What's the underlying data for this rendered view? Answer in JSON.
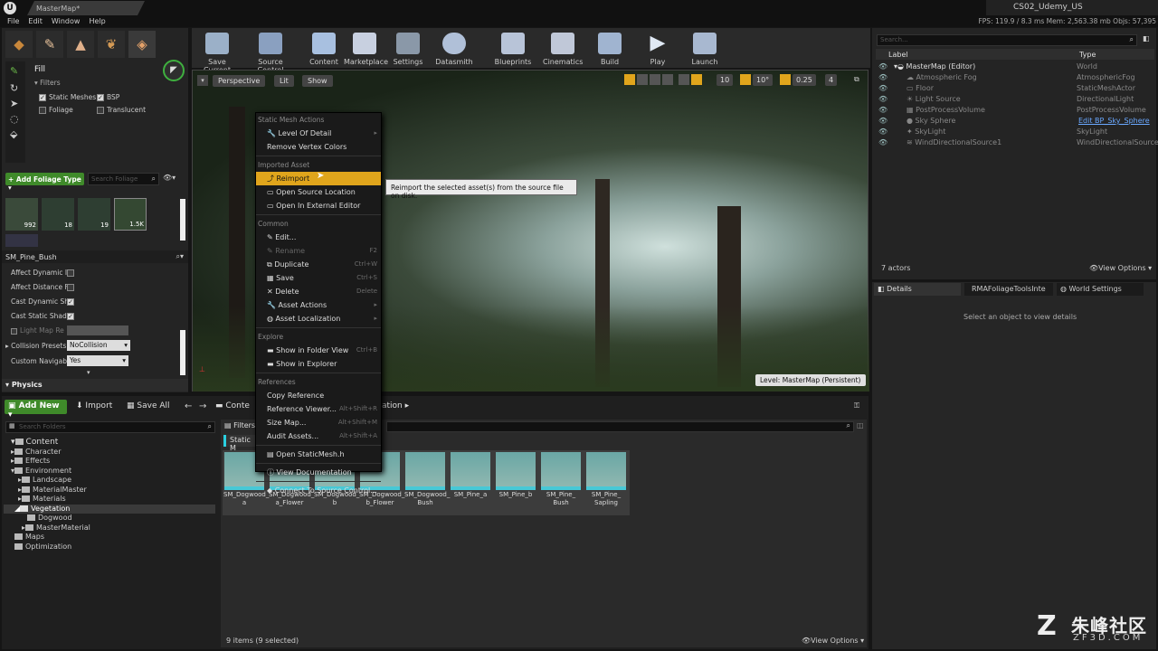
{
  "window": {
    "tab": "MasterMap*",
    "project": "CS02_Udemy_US",
    "stats": "FPS: 119.9 / 8.3 ms  Mem: 2,563.38 mb  Objs: 57,395"
  },
  "menu": [
    "File",
    "Edit",
    "Window",
    "Help"
  ],
  "modes": {
    "title": "Fill",
    "filters_label": "Filters",
    "filters": [
      {
        "label": "Static Meshes",
        "checked": true
      },
      {
        "label": "BSP",
        "checked": true
      },
      {
        "label": "Foliage",
        "checked": false
      },
      {
        "label": "Translucent",
        "checked": false
      }
    ],
    "add_foliage": "+ Add Foliage Type ▾",
    "search_placeholder": "Search Foliage",
    "tiles": [
      {
        "count": "992"
      },
      {
        "count": "18"
      },
      {
        "count": "19"
      },
      {
        "count": "1.5K"
      }
    ],
    "selected_name": "SM_Pine_Bush",
    "props": [
      {
        "label": "Affect Dynamic I",
        "checked": false
      },
      {
        "label": "Affect Distance F",
        "checked": false
      },
      {
        "label": "Cast Dynamic Sh",
        "checked": true
      },
      {
        "label": "Cast Static Shad",
        "checked": true
      },
      {
        "label": "Light Map Re",
        "checked": false
      }
    ],
    "collision_label": "Collision Presets",
    "collision_value": "NoCollision",
    "nav_label": "Custom Navigabl",
    "nav_value": "Yes",
    "physics": "Physics"
  },
  "toolbar": [
    {
      "label": "Save Current"
    },
    {
      "label": "Source Control"
    },
    {
      "label": "Content"
    },
    {
      "label": "Marketplace"
    },
    {
      "label": "Settings"
    },
    {
      "label": "Datasmith"
    },
    {
      "label": "Blueprints"
    },
    {
      "label": "Cinematics"
    },
    {
      "label": "Build"
    },
    {
      "label": "Play"
    },
    {
      "label": "Launch"
    }
  ],
  "viewport": {
    "perspective": "Perspective",
    "lit": "Lit",
    "show": "Show",
    "snap1": "10",
    "snap2": "10°",
    "snap3": "0.25",
    "cams": "4",
    "level": "Level:  MasterMap (Persistent)"
  },
  "context_menu": {
    "sections": [
      {
        "header": "Static Mesh Actions",
        "items": [
          {
            "label": "Level Of Detail",
            "key": "▸"
          },
          {
            "label": "Remove Vertex Colors",
            "key": ""
          }
        ]
      },
      {
        "header": "Imported Asset",
        "items": [
          {
            "label": "Reimport",
            "key": "",
            "selected": true
          },
          {
            "label": "Open Source Location",
            "key": ""
          },
          {
            "label": "Open In External Editor",
            "key": ""
          }
        ]
      },
      {
        "header": "Common",
        "items": [
          {
            "label": "Edit...",
            "key": ""
          },
          {
            "label": "Rename",
            "key": "F2",
            "disabled": true
          },
          {
            "label": "Duplicate",
            "key": "Ctrl+W"
          },
          {
            "label": "Save",
            "key": "Ctrl+S"
          },
          {
            "label": "Delete",
            "key": "Delete"
          },
          {
            "label": "Asset Actions",
            "key": "▸"
          },
          {
            "label": "Asset Localization",
            "key": "▸"
          }
        ]
      },
      {
        "header": "Explore",
        "items": [
          {
            "label": "Show in Folder View",
            "key": "Ctrl+B"
          },
          {
            "label": "Show in Explorer",
            "key": ""
          }
        ]
      },
      {
        "header": "References",
        "items": [
          {
            "label": "Copy Reference",
            "key": ""
          },
          {
            "label": "Reference Viewer...",
            "key": "Alt+Shift+R"
          },
          {
            "label": "Size Map...",
            "key": "Alt+Shift+M"
          },
          {
            "label": "Audit Assets...",
            "key": "Alt+Shift+A"
          }
        ]
      },
      {
        "header": "",
        "items": [
          {
            "label": "Open StaticMesh.h",
            "key": ""
          }
        ]
      },
      {
        "header": "",
        "items": [
          {
            "label": "View Documentation",
            "key": ""
          }
        ]
      },
      {
        "header": "",
        "items": [
          {
            "label": "Connect To Source Control...",
            "key": ""
          }
        ]
      }
    ],
    "tooltip": "Reimport the selected asset(s) from the source file on disk."
  },
  "outliner": {
    "search": "Search...",
    "col_label": "Label",
    "col_type": "Type",
    "rows": [
      {
        "label": "MasterMap (Editor)",
        "type": "World"
      },
      {
        "label": "Atmospheric Fog",
        "type": "AtmosphericFog"
      },
      {
        "label": "Floor",
        "type": "StaticMeshActor"
      },
      {
        "label": "Light Source",
        "type": "DirectionalLight"
      },
      {
        "label": "PostProcessVolume",
        "type": "PostProcessVolume"
      },
      {
        "label": "Sky Sphere",
        "type": "Edit BP_Sky_Sphere"
      },
      {
        "label": "SkyLight",
        "type": "SkyLight"
      },
      {
        "label": "WindDirectionalSource1",
        "type": "WindDirectionalSource"
      }
    ],
    "count": "7 actors",
    "view_options": "View Options ▾"
  },
  "details": {
    "tabs": [
      "Details",
      "RMAFoliageToolsInte",
      "World Settings"
    ],
    "empty": "Select an object to view details"
  },
  "content_browser": {
    "add_new": "Add New ▾",
    "import": "Import",
    "save_all": "Save All",
    "path1": "Conte",
    "path2": "ation",
    "search_folders": "Search Folders",
    "filters": "Filters ▾",
    "type_chip": "Static M",
    "tree": [
      {
        "label": "Content",
        "indent": 0
      },
      {
        "label": "Character",
        "indent": 1
      },
      {
        "label": "Effects",
        "indent": 1
      },
      {
        "label": "Environment",
        "indent": 1
      },
      {
        "label": "Landscape",
        "indent": 2
      },
      {
        "label": "MaterialMaster",
        "indent": 2
      },
      {
        "label": "Materials",
        "indent": 2
      },
      {
        "label": "Vegetation",
        "indent": 2
      },
      {
        "label": "Dogwood",
        "indent": 3
      },
      {
        "label": "MasterMaterial",
        "indent": 3
      },
      {
        "label": "Maps",
        "indent": 1
      },
      {
        "label": "Optimization",
        "indent": 1
      }
    ],
    "assets": [
      {
        "l1": "SM_Dogwood_",
        "l2": "a"
      },
      {
        "l1": "SM_Dogwood_",
        "l2": "a_Flower"
      },
      {
        "l1": "SM_Dogwood_",
        "l2": "b"
      },
      {
        "l1": "SM_Dogwood_",
        "l2": "b_Flower"
      },
      {
        "l1": "SM_Dogwood_",
        "l2": "Bush"
      },
      {
        "l1": "SM_Pine_a",
        "l2": ""
      },
      {
        "l1": "SM_Pine_b",
        "l2": ""
      },
      {
        "l1": "SM_Pine_",
        "l2": "Bush"
      },
      {
        "l1": "SM_Pine_",
        "l2": "Sapling"
      }
    ],
    "status": "9 items (9 selected)",
    "view_options": "View Options ▾"
  },
  "watermark": {
    "cn": "朱峰社区",
    "en": "ZF3D.COM"
  }
}
